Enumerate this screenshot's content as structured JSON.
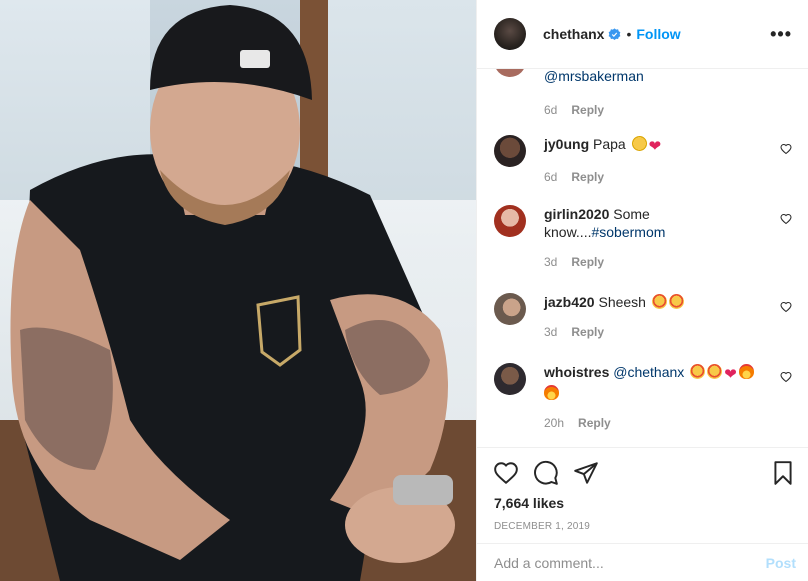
{
  "header": {
    "username": "chethanx",
    "separator": "•",
    "follow_label": "Follow",
    "more_label": "•••"
  },
  "comments": [
    {
      "user": "",
      "text": "@mrsbakerman",
      "time": "6d",
      "reply": "Reply"
    },
    {
      "user": "jy0ung",
      "text": "Papa",
      "time": "6d",
      "reply": "Reply"
    },
    {
      "user": "girlin2020",
      "text": "Some know....",
      "tag": "#sobermom",
      "time": "3d",
      "reply": "Reply"
    },
    {
      "user": "jazb420",
      "text": "Sheesh",
      "time": "3d",
      "reply": "Reply"
    },
    {
      "user": "whoistres",
      "tag": "@chethanx",
      "time": "20h",
      "reply": "Reply"
    }
  ],
  "post": {
    "likes": "7,664 likes",
    "date": "DECEMBER 1, 2019"
  },
  "composer": {
    "placeholder": "Add a comment...",
    "post_label": "Post"
  },
  "colors": {
    "accent": "#0095f6",
    "muted": "#8e8e8e",
    "post_disabled": "#b2dffc",
    "tag": "#00376b"
  }
}
